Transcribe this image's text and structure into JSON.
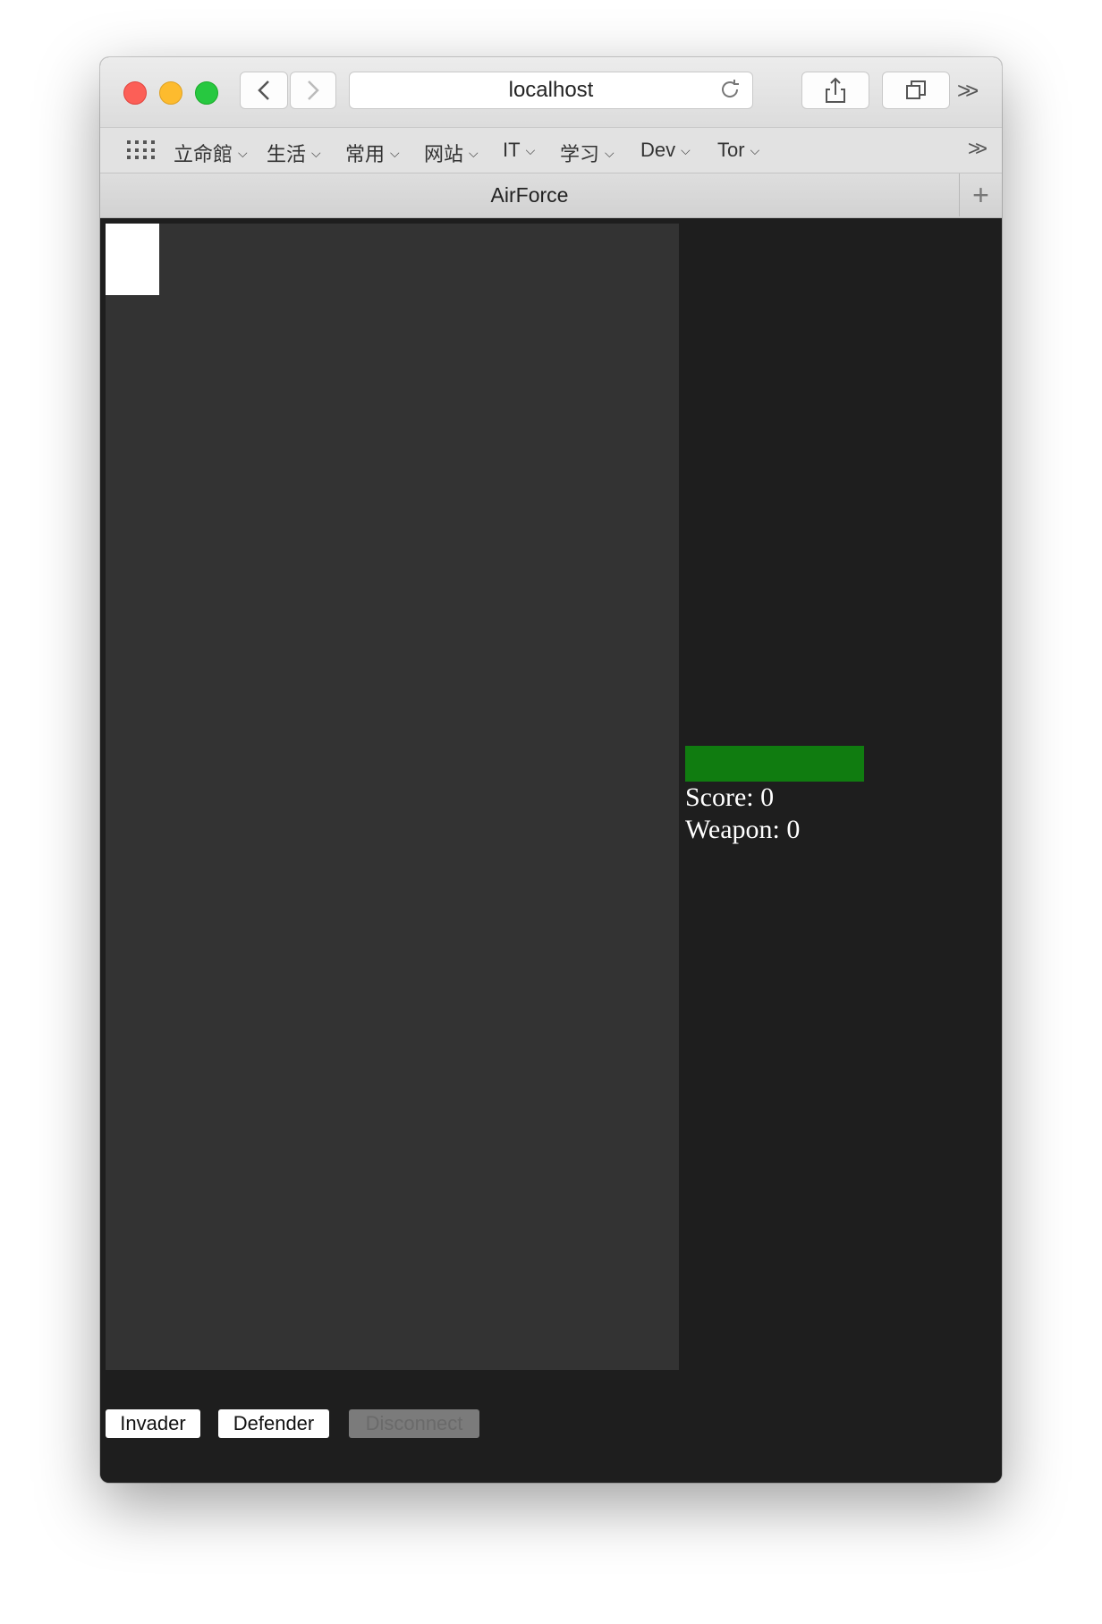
{
  "browser": {
    "address": "localhost",
    "tab_title": "AirForce",
    "bookmarks": [
      {
        "label": "立命館"
      },
      {
        "label": "生活"
      },
      {
        "label": "常用"
      },
      {
        "label": "网站"
      },
      {
        "label": "IT"
      },
      {
        "label": "学习"
      },
      {
        "label": "Dev"
      },
      {
        "label": "Tor"
      }
    ],
    "more_glyph": ">>",
    "new_tab_glyph": "+",
    "icons": [
      "back-chevron-icon",
      "forward-chevron-icon",
      "reload-icon",
      "share-icon",
      "tabs-icon",
      "grid-icon"
    ]
  },
  "game": {
    "health_fraction": 1.0,
    "health_color": "#107c10",
    "score_text": "Score: 0",
    "weapon_text": "Weapon: 0",
    "buttons": {
      "invader": "Invader",
      "defender": "Defender",
      "disconnect": "Disconnect"
    }
  }
}
